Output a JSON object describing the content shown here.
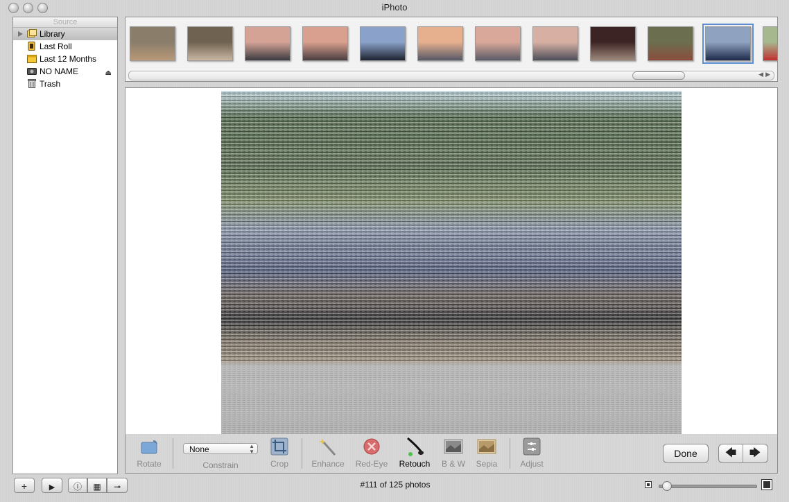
{
  "window": {
    "title": "iPhoto"
  },
  "source": {
    "header": "Source",
    "items": [
      {
        "label": "Library",
        "icon": "library-icon",
        "selected": true
      },
      {
        "label": "Last Roll",
        "icon": "film-roll-icon"
      },
      {
        "label": "Last 12 Months",
        "icon": "calendar-icon"
      },
      {
        "label": "NO NAME",
        "icon": "camera-icon",
        "ejectable": true
      },
      {
        "label": "Trash",
        "icon": "trash-icon"
      }
    ]
  },
  "filmstrip": {
    "selected_index": 10,
    "thumbnails": [
      {
        "icon": "photo-thumbnail",
        "colors": [
          "#8a7d6a",
          "#b89978"
        ]
      },
      {
        "icon": "photo-thumbnail",
        "colors": [
          "#6f6250",
          "#c9b6a3"
        ]
      },
      {
        "icon": "photo-thumbnail",
        "colors": [
          "#d4a396",
          "#3b3a40"
        ]
      },
      {
        "icon": "photo-thumbnail",
        "colors": [
          "#d9a08f",
          "#4a3d3f"
        ]
      },
      {
        "icon": "photo-thumbnail",
        "colors": [
          "#8aa2c9",
          "#1e2330"
        ]
      },
      {
        "icon": "photo-thumbnail",
        "colors": [
          "#e6b08f",
          "#565866"
        ]
      },
      {
        "icon": "photo-thumbnail",
        "colors": [
          "#d9a89a",
          "#5a5a66"
        ]
      },
      {
        "icon": "photo-thumbnail",
        "colors": [
          "#d8b0a3",
          "#4d4f5a"
        ]
      },
      {
        "icon": "photo-thumbnail",
        "colors": [
          "#3d2424",
          "#9e8a7c"
        ]
      },
      {
        "icon": "photo-thumbnail",
        "colors": [
          "#6b6f4f",
          "#8a4d3d"
        ]
      },
      {
        "icon": "photo-thumbnail",
        "colors": [
          "#8fa3c0",
          "#1f2a4a"
        ]
      },
      {
        "icon": "photo-thumbnail",
        "colors": [
          "#a6b88e",
          "#c03030"
        ]
      }
    ]
  },
  "toolbar": {
    "tools": [
      {
        "label": "Rotate",
        "icon": "rotate-icon",
        "enabled": false
      },
      {
        "label": "Crop",
        "icon": "crop-icon",
        "enabled": false
      },
      {
        "label": "Enhance",
        "icon": "magic-wand-icon",
        "enabled": false
      },
      {
        "label": "Red-Eye",
        "icon": "red-eye-icon",
        "enabled": false
      },
      {
        "label": "Retouch",
        "icon": "brush-icon",
        "enabled": true,
        "active": true
      },
      {
        "label": "B & W",
        "icon": "bw-icon",
        "enabled": false
      },
      {
        "label": "Sepia",
        "icon": "sepia-icon",
        "enabled": false
      },
      {
        "label": "Adjust",
        "icon": "adjust-icon",
        "enabled": false
      }
    ],
    "constrain": {
      "label": "Constrain",
      "value": "None"
    },
    "done_label": "Done",
    "prev_icon": "arrow-left-icon",
    "next_icon": "arrow-right-icon"
  },
  "statusbar": {
    "text": "#111 of 125 photos",
    "zoom_level": 0.03
  },
  "colors": {
    "accent": "#5e8fd6",
    "selection": "#c4c4c4"
  }
}
